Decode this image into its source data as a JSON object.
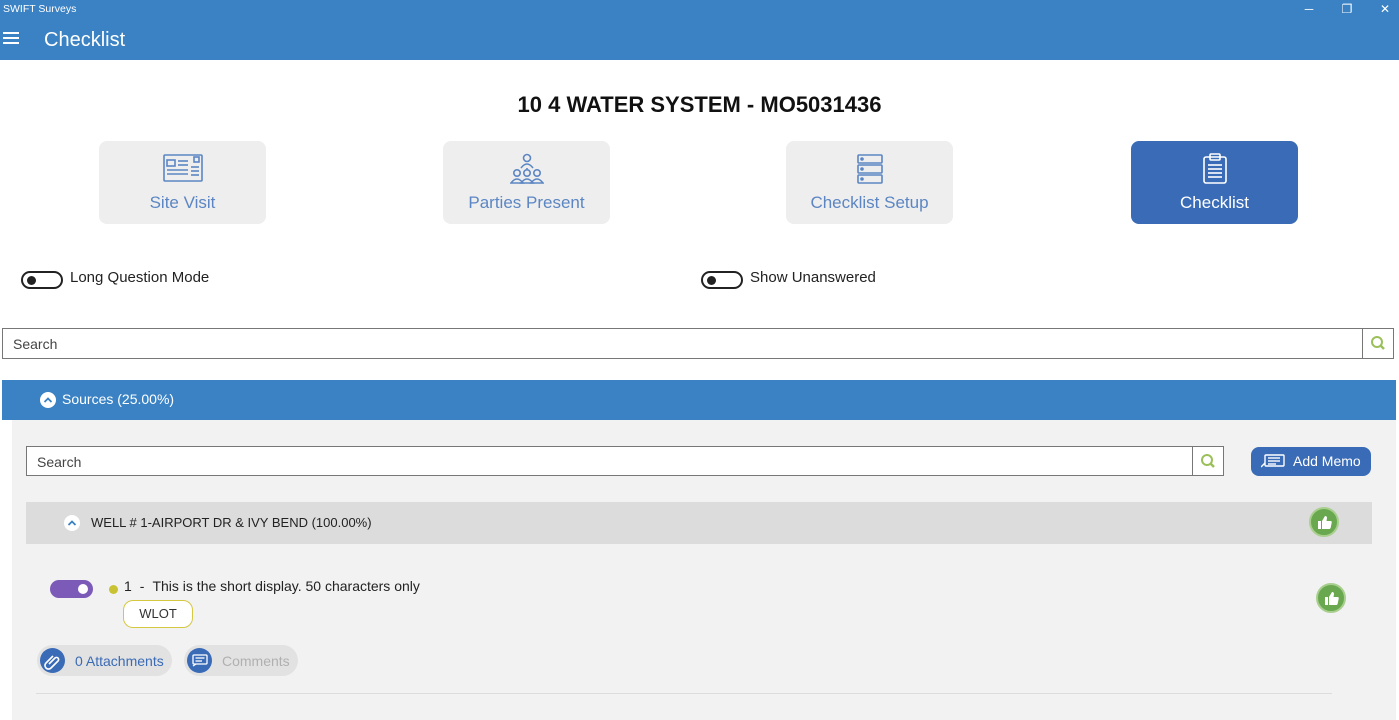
{
  "window": {
    "title": "SWIFT Surveys",
    "controls": {
      "minimize": "─",
      "maximize": "❐",
      "close": "✕"
    }
  },
  "header": {
    "menu_icon": "hamburger-menu-icon",
    "title": "Checklist"
  },
  "main_heading": "10 4 WATER SYSTEM - MO5031436",
  "nav_tiles": [
    {
      "label": "Site Visit",
      "icon": "site-visit-icon",
      "active": false
    },
    {
      "label": "Parties Present",
      "icon": "people-icon",
      "active": false
    },
    {
      "label": "Checklist Setup",
      "icon": "server-list-icon",
      "active": false
    },
    {
      "label": "Checklist",
      "icon": "clipboard-icon",
      "active": true
    }
  ],
  "toggles": {
    "long_question_mode": {
      "label": "Long Question Mode",
      "on": false
    },
    "show_unanswered": {
      "label": "Show Unanswered",
      "on": false
    }
  },
  "search": {
    "placeholder": "Search"
  },
  "section": {
    "label": "Sources (25.00%)",
    "search_placeholder": "Search",
    "add_memo_label": "Add Memo",
    "subsection": {
      "label": "WELL # 1-AIRPORT DR & IVY BEND (100.00%)",
      "question": {
        "number": "1",
        "separator": "-",
        "text": "This is the short display. 50 characters only",
        "answered": true,
        "tag": "WLOT"
      }
    },
    "attachments_label": "0 Attachments",
    "comments_label": "Comments"
  },
  "colors": {
    "brand_blue": "#3a82c4",
    "active_tile": "#3a6bb6",
    "thumb_green": "#6aa84f",
    "toggle_purple": "#7b5ab8",
    "status_dot": "#c9c233"
  }
}
